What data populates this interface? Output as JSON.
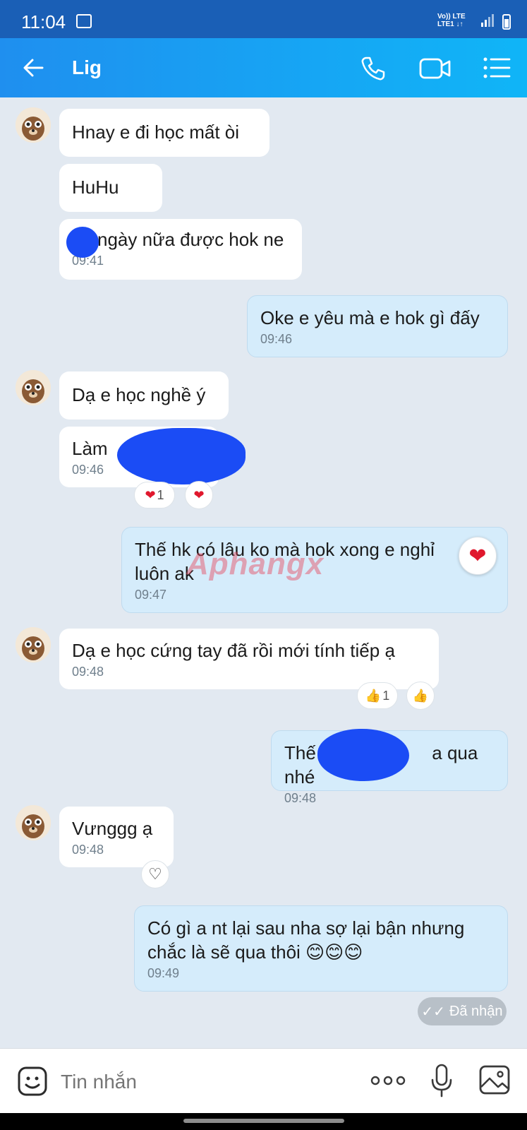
{
  "status_bar": {
    "time": "11:04",
    "network_top": "Vo)) LTE",
    "network_bottom": "LTE1 ↓↑"
  },
  "header": {
    "contact_name": "Lig"
  },
  "messages": [
    {
      "dir": "in",
      "text": "Hnay e đi học mất òi"
    },
    {
      "dir": "in",
      "text": "HuHu"
    },
    {
      "dir": "in",
      "text": "ngày nữa được hok ne",
      "time": "09:41"
    },
    {
      "dir": "out",
      "text": "Oke e yêu mà e hok gì đấy",
      "time": "09:46"
    },
    {
      "dir": "in",
      "text": "Dạ e học nghề ý"
    },
    {
      "dir": "in",
      "text": "Làm",
      "time": "09:46"
    },
    {
      "dir": "out",
      "text": "Thế hk có lâu ko mà hok xong e nghỉ luôn ak",
      "time": "09:47"
    },
    {
      "dir": "in",
      "text": "Dạ e học cứng tay đã rồi mới tính tiếp ạ",
      "time": "09:48"
    },
    {
      "dir": "out",
      "text_start": "Thế",
      "text_end": "a qua nhé",
      "time": "09:48"
    },
    {
      "dir": "in",
      "text": "Vưnggg ạ",
      "time": "09:48"
    },
    {
      "dir": "out",
      "text": "Có gì a nt lại sau nha sợ lại bận nhưng chắc là sẽ qua thôi 😊😊😊",
      "time": "09:49"
    }
  ],
  "reactions": {
    "heart_count": "1",
    "like_count": "1"
  },
  "delivery_status": "Đã nhận",
  "watermark": "Aphangx",
  "composer": {
    "placeholder": "Tin nhắn"
  },
  "colors": {
    "header_start": "#1f8fef",
    "header_end": "#10b5f7",
    "outgoing_bubble": "#d5ecfb",
    "background": "#e2e9f1"
  }
}
